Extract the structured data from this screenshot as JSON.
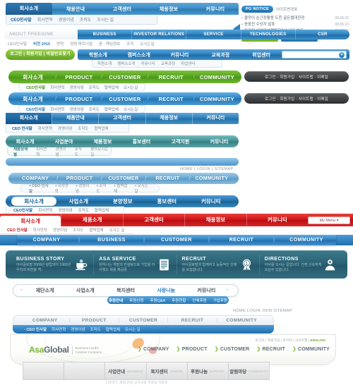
{
  "bar1": {
    "items": [
      "회사소개",
      "채용안내",
      "고객센터",
      "채용정보",
      "커뮤니티"
    ],
    "sub": [
      "CEO인사말",
      "회사연혁",
      "경영이념",
      "조직도",
      "오시는 길"
    ]
  },
  "notice": {
    "badge": "PG NOTICE",
    "label": "사이트변경표",
    "items": [
      {
        "text": "울맛이 순근장활용 도친 골든벨대한정",
        "date": "09.06.22"
      },
      {
        "text": "윤웅전 수상자 발표",
        "date": "09.06.10"
      },
      {
        "text": "포리진 네이밍브랜뜻모인수상자 발표",
        "date": "09.06.02"
      }
    ]
  },
  "bar2": {
    "lead": "ABOUT FREEGINE",
    "items": [
      "BUSINESS",
      "INVESTOR RELATIONS",
      "SERVICE",
      "TECHNOLOGIES",
      "CSR"
    ],
    "sub": [
      "CEO인사말",
      "비전 2015",
      "연혁",
      "경영 파트너쉽",
      "윤 · 핵심정보",
      "조직",
      "오시는길"
    ]
  },
  "bar3": {
    "pill": "로그인 | 회원가입 | 비밀번호찾기",
    "items": [
      "학원소개",
      "캠퍼스소개",
      "커뮤니티",
      "교육과정",
      "취업센터"
    ],
    "sub": [
      "학원소개",
      "캠퍼스소개",
      "커뮤니티",
      "교육과정",
      "취업센터"
    ],
    "select_placeholder": "",
    "chevron": "▾"
  },
  "green_pill": {
    "items": [
      "회사소개",
      "PRODUCT",
      "CUSTOMER",
      "RECRUIT",
      "COMMUNITY"
    ],
    "separator": "/",
    "sub": [
      "CEO인사말",
      "회사연혁",
      "경영이념",
      "조직도",
      "협력업체",
      "오시는길"
    ],
    "dark": "로그인 · 회원가입 · 사이트맵 · 이메일"
  },
  "blue_pill": {
    "items": [
      "회사소개",
      "PRODUCT",
      "CUSTOMER",
      "RECRUIT",
      "COMMUNITY"
    ],
    "separator": "/",
    "sub": [
      "CEO인사말",
      "회사연혁",
      "경영이념",
      "조직도",
      "협력업체",
      "오시는길"
    ],
    "dark": "로그인 · 회원가입 · 사이트맵 · 이메일"
  },
  "seg_nav": {
    "items": [
      "회사소개",
      "제품안내",
      "고객센터",
      "채용정보",
      "커뮤니티"
    ],
    "sub": [
      "CEO 인사말",
      "회사연혁",
      "경영이념",
      "조직도",
      "협력업체",
      "오시는길"
    ]
  },
  "teal_nav": {
    "items": [
      "회사소개",
      "사업분야",
      "제품정보",
      "홍보센터",
      "고객지원",
      "커뮤니티"
    ],
    "sub": [
      "제품상세별",
      "회사연혁",
      "경영이념",
      "조직도",
      "찾아오시는길"
    ]
  },
  "util_1": "HOME  |  LOGIN  |  SITEMAP",
  "soft_pill": {
    "items": [
      "COMPANY",
      "PRODUCT",
      "CUSTOMER",
      "RECRUIT",
      "COMMUNITY"
    ],
    "separator": "/",
    "sub": [
      "CEO 인사말",
      "회사연혁",
      "경영이념",
      "조직도",
      "협력업체",
      "오시는 길"
    ]
  },
  "deep_pill": {
    "items": [
      "회사소개",
      "사업소개",
      "분양정보",
      "홍보센터",
      "커뮤니티"
    ],
    "sub": [
      "CEO인사말",
      "회사연혁",
      "경영이념",
      "조직도",
      "협력업체",
      "오시는길"
    ]
  },
  "red_nav": {
    "items": [
      "회사소개",
      "제품소개",
      "고객센터",
      "채용정보",
      "커뮤니티"
    ],
    "mymenu": "My Menu ▾",
    "sub": [
      "CEO 인사말",
      "회사연혁",
      "경영이념",
      "조직도",
      "협력업체",
      "오시는 길"
    ]
  },
  "wide_bar": {
    "items": [
      "COMPANY",
      "BUSINESS",
      "CUSTOMER",
      "RECRUIT",
      "COMMUNITY"
    ],
    "separator": "|"
  },
  "story_card": {
    "cells": [
      {
        "title": "BUSINESS STORY",
        "desc": "아사글로벌 2009년 설립되어\n1960년 우리의 비전을 객..",
        "icon": "coffee-cup-icon"
      },
      {
        "title": "ASA SERVICE",
        "desc": "원하시는 개발의 컨설팅으로\n기업을 아사월드 화를 제공중",
        "icon": "document-list-icon"
      },
      {
        "title": "RECRUIT",
        "desc": "아사글로벌과 함께하고\n능동적인 인재를 모집합니다.",
        "icon": "award-ribbon-icon"
      },
      {
        "title": "DIRECTIONS",
        "desc": "아사를 오시는 길입니다.\n간편,신속하게 오실수 있습니다.",
        "icon": "person-icon"
      }
    ]
  },
  "white_nav": {
    "items": [
      "재단소개",
      "사업소개",
      "복지센터",
      "사랑나눔",
      "커뮤니티"
    ],
    "sub": [
      "후원안내",
      "후원신청",
      "후원Q&A",
      "후원현황",
      "단체후원",
      "기업후원"
    ]
  },
  "util_2": "HOME   LOGIN   JOIN   SITEMAP",
  "pale_nav": {
    "items": [
      "COMPANY",
      "PRODUCT",
      "CUSTOMER",
      "RECRUIT",
      "COMMUNITY"
    ],
    "separator": "|",
    "sub": [
      "CEO 인사말",
      "회사연혁",
      "경영이념",
      "조직도",
      "협력업체",
      "오시는 길"
    ]
  },
  "asa": {
    "logo_a": "Asa",
    "logo_b": "Global",
    "tagline_1": "Business Leader",
    "tagline_2": "Creative Company",
    "util": "로그인 |  회원가입 |  관리자 |  사이트맵 | ",
    "util_en": "ENGLISH",
    "menu": [
      "COMPANY",
      "PRODUCT",
      "CUSTOMER",
      "RECRUIT",
      "COMMUNITY"
    ],
    "arrow": "❯"
  },
  "gray_footer": {
    "tabs": [
      {
        "ko": "",
        "en": ""
      },
      {
        "ko": "",
        "en": ""
      },
      {
        "ko": "사업안내",
        "en": "BUSINESS"
      },
      {
        "ko": "복지센터",
        "en": "CENTER"
      },
      {
        "ko": "후원나눔",
        "en": "SUPPORT"
      },
      {
        "ko": "알림마당",
        "en": "COMMUNITY"
      }
    ],
    "note": "다운로드 회원  안내  공지사항  자료실 자료실"
  },
  "colors": {
    "blue": "#2a7cba",
    "green": "#7cc142",
    "red": "#cf1116",
    "teal": "#3f8e92",
    "dark": "#2c2f31"
  }
}
